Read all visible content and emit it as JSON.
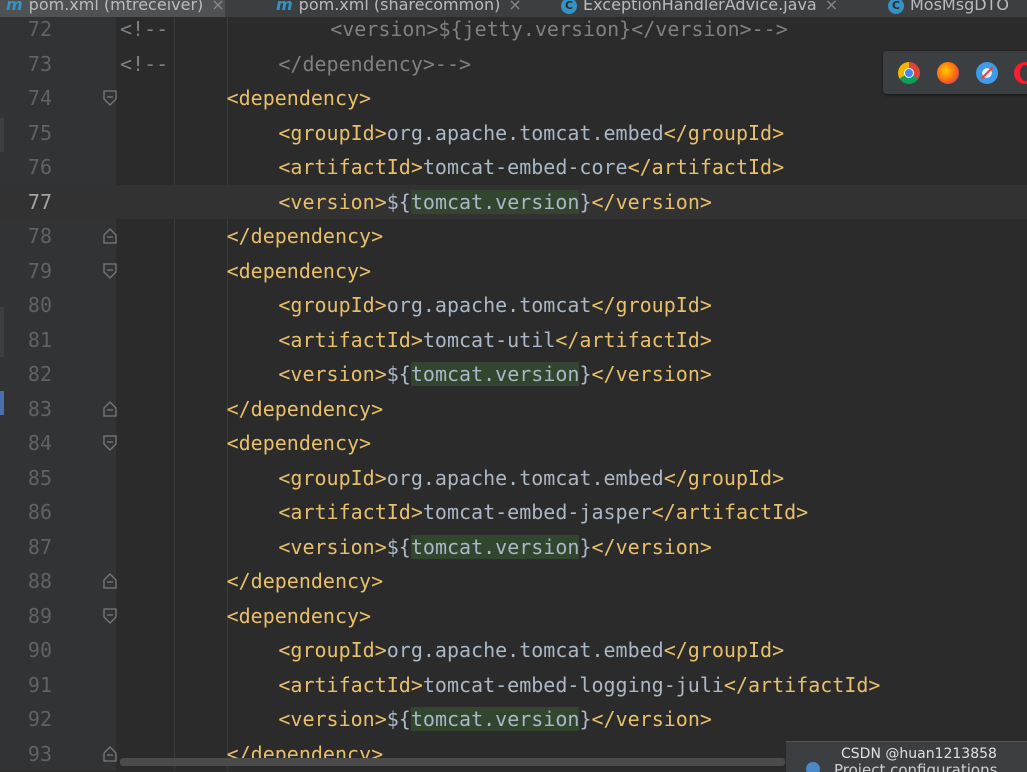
{
  "tabs": [
    {
      "icon": "maven-icon",
      "label": "pom.xml (mtreceiver)",
      "active": true
    },
    {
      "icon": "maven-icon",
      "label": "pom.xml (sharecommon)",
      "active": false
    },
    {
      "icon": "class-icon",
      "label": "ExceptionHandlerAdvice.java",
      "active": false
    },
    {
      "icon": "class-icon",
      "label": "MosMsgDTO",
      "active": false
    }
  ],
  "editor": {
    "current_line": 77,
    "lines": [
      {
        "n": "72",
        "cmt": "<!--",
        "indent": 4,
        "parts": [
          {
            "t": "cmt",
            "s": "<version>${jetty.version}</version>-->"
          }
        ]
      },
      {
        "n": "73",
        "cmt": "<!--",
        "indent": 3,
        "parts": [
          {
            "t": "cmt",
            "s": "</dependency>-->"
          }
        ]
      },
      {
        "n": "74",
        "indent": 2,
        "fold": "open",
        "parts": [
          {
            "t": "tag",
            "s": "<dependency>"
          }
        ]
      },
      {
        "n": "75",
        "indent": 3,
        "parts": [
          {
            "t": "tag",
            "s": "<groupId>"
          },
          {
            "t": "val",
            "s": "org.apache.tomcat.embed"
          },
          {
            "t": "tag",
            "s": "</groupId>"
          }
        ]
      },
      {
        "n": "76",
        "indent": 3,
        "parts": [
          {
            "t": "tag",
            "s": "<artifactId>"
          },
          {
            "t": "val",
            "s": "tomcat-embed-core"
          },
          {
            "t": "tag",
            "s": "</artifactId>"
          }
        ]
      },
      {
        "n": "77",
        "indent": 3,
        "parts": [
          {
            "t": "tag",
            "s": "<version>"
          },
          {
            "t": "val",
            "s": "${"
          },
          {
            "t": "hl",
            "s": "tomcat.version"
          },
          {
            "t": "val",
            "s": "}"
          },
          {
            "t": "tag",
            "s": "</version>"
          }
        ]
      },
      {
        "n": "78",
        "indent": 2,
        "fold": "close",
        "parts": [
          {
            "t": "tag",
            "s": "</dependency>"
          }
        ]
      },
      {
        "n": "79",
        "indent": 2,
        "fold": "open",
        "parts": [
          {
            "t": "tag",
            "s": "<dependency>"
          }
        ]
      },
      {
        "n": "80",
        "indent": 3,
        "parts": [
          {
            "t": "tag",
            "s": "<groupId>"
          },
          {
            "t": "val",
            "s": "org.apache.tomcat"
          },
          {
            "t": "tag",
            "s": "</groupId>"
          }
        ]
      },
      {
        "n": "81",
        "indent": 3,
        "parts": [
          {
            "t": "tag",
            "s": "<artifactId>"
          },
          {
            "t": "val",
            "s": "tomcat-util"
          },
          {
            "t": "tag",
            "s": "</artifactId>"
          }
        ]
      },
      {
        "n": "82",
        "indent": 3,
        "parts": [
          {
            "t": "tag",
            "s": "<version>"
          },
          {
            "t": "val",
            "s": "${"
          },
          {
            "t": "hl",
            "s": "tomcat.version"
          },
          {
            "t": "val",
            "s": "}"
          },
          {
            "t": "tag",
            "s": "</version>"
          }
        ]
      },
      {
        "n": "83",
        "indent": 2,
        "fold": "close",
        "parts": [
          {
            "t": "tag",
            "s": "</dependency>"
          }
        ]
      },
      {
        "n": "84",
        "indent": 2,
        "fold": "open",
        "parts": [
          {
            "t": "tag",
            "s": "<dependency>"
          }
        ]
      },
      {
        "n": "85",
        "indent": 3,
        "parts": [
          {
            "t": "tag",
            "s": "<groupId>"
          },
          {
            "t": "val",
            "s": "org.apache.tomcat.embed"
          },
          {
            "t": "tag",
            "s": "</groupId>"
          }
        ]
      },
      {
        "n": "86",
        "indent": 3,
        "parts": [
          {
            "t": "tag",
            "s": "<artifactId>"
          },
          {
            "t": "val",
            "s": "tomcat-embed-jasper"
          },
          {
            "t": "tag",
            "s": "</artifactId>"
          }
        ]
      },
      {
        "n": "87",
        "indent": 3,
        "parts": [
          {
            "t": "tag",
            "s": "<version>"
          },
          {
            "t": "val",
            "s": "${"
          },
          {
            "t": "hl",
            "s": "tomcat.version"
          },
          {
            "t": "val",
            "s": "}"
          },
          {
            "t": "tag",
            "s": "</version>"
          }
        ]
      },
      {
        "n": "88",
        "indent": 2,
        "fold": "close",
        "parts": [
          {
            "t": "tag",
            "s": "</dependency>"
          }
        ]
      },
      {
        "n": "89",
        "indent": 2,
        "fold": "open",
        "parts": [
          {
            "t": "tag",
            "s": "<dependency>"
          }
        ]
      },
      {
        "n": "90",
        "indent": 3,
        "parts": [
          {
            "t": "tag",
            "s": "<groupId>"
          },
          {
            "t": "val",
            "s": "org.apache.tomcat.embed"
          },
          {
            "t": "tag",
            "s": "</groupId>"
          }
        ]
      },
      {
        "n": "91",
        "indent": 3,
        "parts": [
          {
            "t": "tag",
            "s": "<artifactId>"
          },
          {
            "t": "val",
            "s": "tomcat-embed-logging-juli"
          },
          {
            "t": "tag",
            "s": "</artifactId>"
          }
        ]
      },
      {
        "n": "92",
        "indent": 3,
        "parts": [
          {
            "t": "tag",
            "s": "<version>"
          },
          {
            "t": "val",
            "s": "${"
          },
          {
            "t": "hl",
            "s": "tomcat.version"
          },
          {
            "t": "val",
            "s": "}"
          },
          {
            "t": "tag",
            "s": "</version>"
          }
        ]
      },
      {
        "n": "93",
        "indent": 2,
        "fold": "close",
        "parts": [
          {
            "t": "tag",
            "s": "</dependency>"
          }
        ]
      }
    ]
  },
  "browsers": [
    "chrome-icon",
    "firefox-icon",
    "safari-icon",
    "opera-icon"
  ],
  "watermark": {
    "text": "CSDN @huan1213858",
    "notification": "Project configurations"
  },
  "colors": {
    "tag": "#e8bf6a",
    "comment": "#808080",
    "text": "#a9b7c6",
    "highlight": "#32452f",
    "background": "#2b2b2b"
  }
}
